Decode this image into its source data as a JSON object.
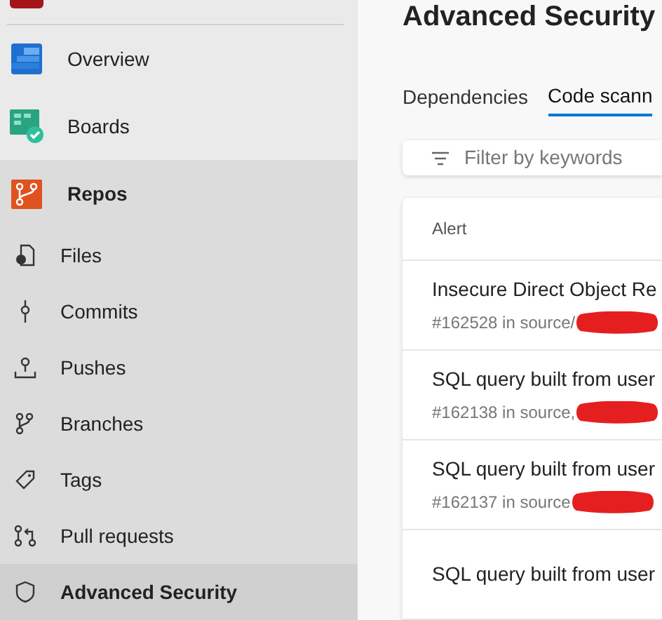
{
  "sidebar": {
    "items": [
      {
        "label": "Overview",
        "selected": false
      },
      {
        "label": "Boards",
        "selected": false
      },
      {
        "label": "Repos",
        "selected": false,
        "expanded": true,
        "children": [
          {
            "label": "Files",
            "selected": false
          },
          {
            "label": "Commits",
            "selected": false
          },
          {
            "label": "Pushes",
            "selected": false
          },
          {
            "label": "Branches",
            "selected": false
          },
          {
            "label": "Tags",
            "selected": false
          },
          {
            "label": "Pull requests",
            "selected": false
          },
          {
            "label": "Advanced Security",
            "selected": true
          }
        ]
      }
    ]
  },
  "page": {
    "title": "Advanced Security"
  },
  "tabs": [
    {
      "label": "Dependencies",
      "selected": false
    },
    {
      "label": "Code scann",
      "selected": true
    }
  ],
  "filter": {
    "placeholder": "Filter by keywords"
  },
  "table": {
    "columns": [
      "Alert"
    ],
    "rows": [
      {
        "title": "Insecure Direct Object Re",
        "detail": "#162528 in source/",
        "redacted": true
      },
      {
        "title": "SQL query built from user",
        "detail": "#162138 in source,",
        "redacted": true
      },
      {
        "title": "SQL query built from user",
        "detail": "#162137 in source",
        "redacted": true
      },
      {
        "title": "SQL query built from user"
      }
    ]
  }
}
